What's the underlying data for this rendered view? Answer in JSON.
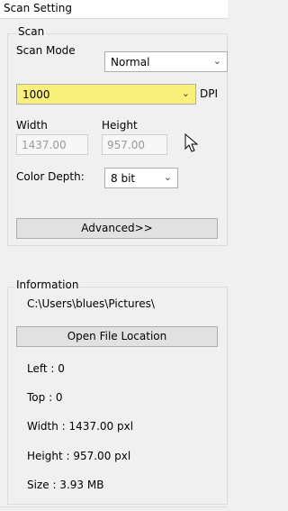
{
  "window": {
    "title": "Scan Setting"
  },
  "scan": {
    "group_label": "Scan",
    "mode_label": "Scan Mode",
    "mode_value": "Normal",
    "dpi_value": "1000",
    "dpi_label": "DPI",
    "width_label": "Width",
    "height_label": "Height",
    "width_value": "1437.00",
    "height_value": "957.00",
    "color_depth_label": "Color Depth:",
    "color_depth_value": "8 bit",
    "advanced_label": "Advanced>>"
  },
  "information": {
    "group_label": "Information",
    "path": "C:\\Users\\blues\\Pictures\\",
    "open_location_label": "Open File Location",
    "left": "Left : 0",
    "top": "Top : 0",
    "width": "Width : 1437.00 pxl",
    "height": "Height : 957.00 pxl",
    "size": "Size : 3.93 MB"
  },
  "colors": {
    "highlight": "#f8f07a",
    "button_face": "#e1e1e1"
  },
  "icons": [
    "chevron-down-icon",
    "mouse-pointer-icon"
  ]
}
